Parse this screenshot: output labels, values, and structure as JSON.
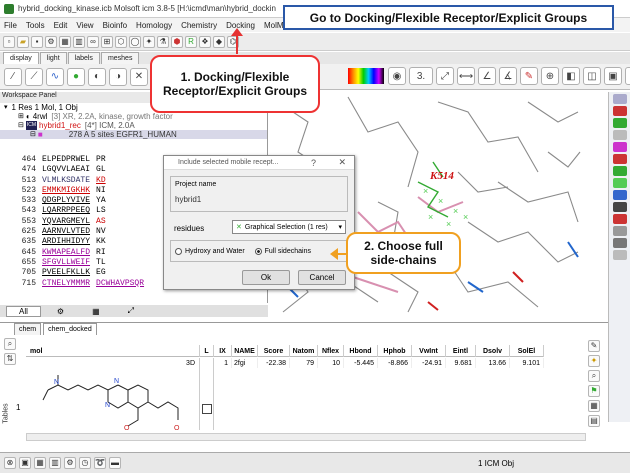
{
  "window": {
    "title": "hybrid_docking_kinase.icb Molsoft icm 3.8-5 [H:\\icmd\\man\\hybrid_dockin"
  },
  "menu": [
    "File",
    "Tools",
    "Edit",
    "View",
    "Bioinfo",
    "Homology",
    "Chemistry",
    "Docking",
    "MolMec"
  ],
  "toolbar_tabs": [
    "display",
    "light",
    "labels",
    "meshes"
  ],
  "workspace": {
    "label": "Workspace Panel",
    "root": "1 Res 1 Mol, 1 Obj",
    "obj1": "4rwl",
    "obj1_extra": "[3] XR, 2.2A, kinase, growth factor",
    "obj2": "hybrid1_rec",
    "obj2_extra": "[4*] ICM, 2.0A",
    "chain": "278 A 5 sites EGFR1_HUMAN"
  },
  "sequence": [
    {
      "num": "464",
      "seq": "ELPEDPRWEL",
      "tail": "PR"
    },
    {
      "num": "474",
      "seq": "LGQVVLAEAI",
      "tail": "GL"
    },
    {
      "num": "513",
      "seq": "VLMLKSDATE",
      "tail": "KD"
    },
    {
      "num": "523",
      "seq": "EMMKMIGKHK",
      "tail": "NI"
    },
    {
      "num": "533",
      "seq": "QDGPLYVIVE",
      "tail": "YA"
    },
    {
      "num": "543",
      "seq": "LQARRPPEEQ",
      "tail": "LS"
    },
    {
      "num": "553",
      "seq": "YQVARGMEYL",
      "tail": "AS"
    },
    {
      "num": "625",
      "seq": "AARNVLVTED",
      "tail": "NV"
    },
    {
      "num": "635",
      "seq": "ARDIHHIDYY",
      "tail": "KK"
    },
    {
      "num": "645",
      "seq": "KWMAPEALFD",
      "tail": "RI"
    },
    {
      "num": "655",
      "seq": "SFGVLLWEIF",
      "tail": "TL"
    },
    {
      "num": "705",
      "seq": "PVEELFKLLK",
      "tail": "EG"
    },
    {
      "num": "715",
      "seq": "CTNELYMMMR",
      "tail": "DCWHAVPSQR"
    }
  ],
  "bottom_tabs": {
    "all": "All"
  },
  "dialog": {
    "title": "Include selected mobile recept...",
    "help": "?",
    "close": "✕",
    "group_label": "Project name",
    "project_name": "hybrid1",
    "residues_label": "residues",
    "residues_value": "Graphical Selection (1 res)",
    "option1": "Hydroxy and Water",
    "option2": "Full sidechains",
    "selected_option": "Full sidechains",
    "ok": "Ok",
    "cancel": "Cancel"
  },
  "residue_label": "K514",
  "table": {
    "tabs": [
      "chem",
      "chem_docked"
    ],
    "columns": [
      "mol",
      "L",
      "IX",
      "NAME",
      "Score",
      "Natom",
      "Nflex",
      "Hbond",
      "Hphob",
      "VwInt",
      "Eintl",
      "Dsolv",
      "SolEl"
    ],
    "row_index": "1",
    "row": {
      "mol_tag": "3D",
      "IX": "1",
      "NAME": "2fgi",
      "Score": "-22.38",
      "Natom": "79",
      "Nflex": "10",
      "Hbond": "-5.445",
      "Hphob": "-8.866",
      "VwInt": "-24.91",
      "Eintl": "9.681",
      "Dsolv": "13.66",
      "SolEl": "9.101"
    },
    "side_label": "Tables"
  },
  "status": {
    "obj_count": "1 ICM Obj"
  },
  "annotations": {
    "top_box": "Go to Docking/Flexible Receptor/Explicit Groups",
    "callout1": "1. Docking/Flexible Receptor/Explicit Groups",
    "callout2": "2. Choose full side-chains"
  },
  "colors": {
    "callout_border": "#e53333",
    "top_box_border": "#2a58a8",
    "arrow_red": "#e53333",
    "arrow_orange": "#f0a020",
    "residue": "#cc1111"
  }
}
